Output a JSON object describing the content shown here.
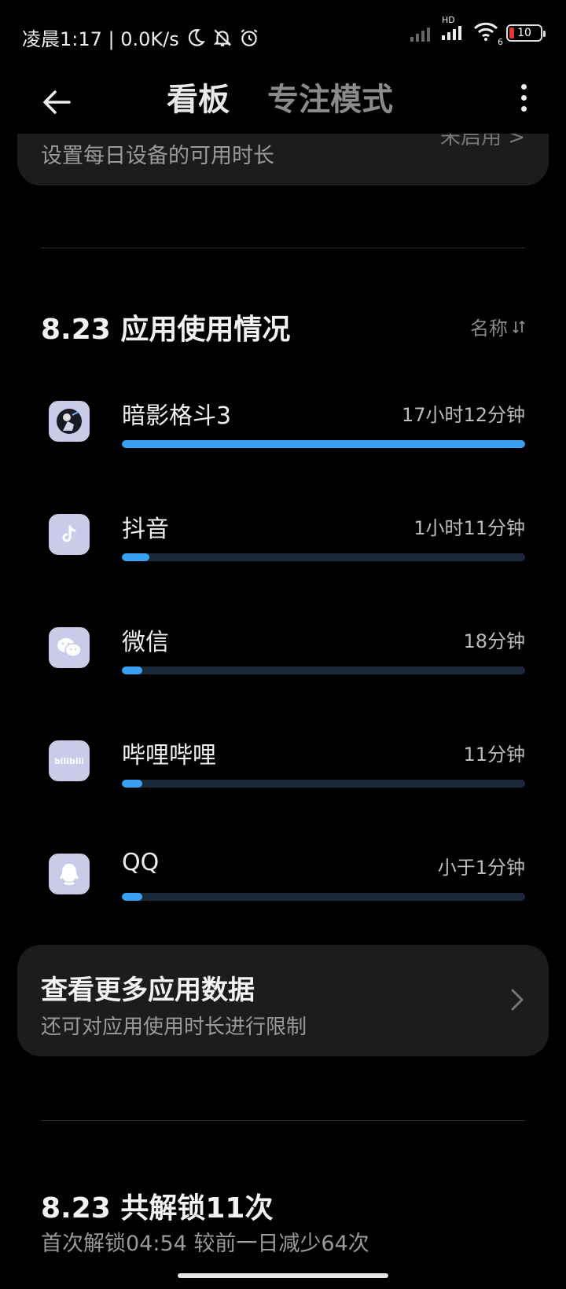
{
  "status_bar": {
    "time_text": "凌晨1:17 | 0.0K/s",
    "battery_level": "10",
    "network_label": "HD",
    "wifi_badge": "6"
  },
  "header": {
    "tab_board": "看板",
    "tab_focus": "专注模式"
  },
  "top_card": {
    "subtitle": "设置每日设备的可用时长",
    "status": "未启用 >"
  },
  "usage": {
    "title": "8.23 应用使用情况",
    "sort_label": "名称",
    "apps": [
      {
        "name": "暗影格斗3",
        "time": "17小时12分钟",
        "icon": "shadow-fight-icon",
        "progress": 1.0
      },
      {
        "name": "抖音",
        "time": "1小时11分钟",
        "icon": "douyin-icon",
        "progress": 0.069
      },
      {
        "name": "微信",
        "time": "18分钟",
        "icon": "wechat-icon",
        "progress": 0.05
      },
      {
        "name": "哔哩哔哩",
        "time": "11分钟",
        "icon": "bilibili-icon",
        "progress": 0.05
      },
      {
        "name": "QQ",
        "time": "小于1分钟",
        "icon": "qq-icon",
        "progress": 0.05
      }
    ]
  },
  "more_card": {
    "title": "查看更多应用数据",
    "subtitle": "还可对应用使用时长进行限制"
  },
  "unlock": {
    "title": "8.23 共解锁11次",
    "subtitle": "首次解锁04:54   较前一日减少64次"
  },
  "colors": {
    "accent": "#3aa0f2",
    "track": "#1b2a38",
    "card": "#1c1c1c",
    "icon_bg": "#c9cbe8"
  }
}
